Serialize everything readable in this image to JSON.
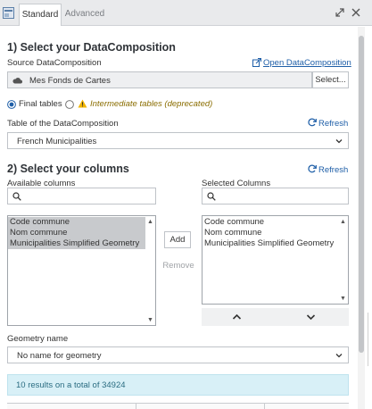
{
  "tabs": {
    "standard": "Standard",
    "advanced": "Advanced"
  },
  "section1": {
    "title": "1) Select your DataComposition",
    "source_label": "Source DataComposition",
    "open_link": "Open DataComposition",
    "source_value": "Mes Fonds de Cartes",
    "select_button": "Select...",
    "radio_final": "Final tables",
    "radio_intermediate": "Intermediate tables (deprecated)",
    "table_label": "Table of the DataComposition",
    "refresh": "Refresh",
    "table_value": "French Municipalities"
  },
  "section2": {
    "title": "2) Select your columns",
    "refresh": "Refresh",
    "available_label": "Available columns",
    "selected_label": "Selected Columns",
    "available_items": [
      "Code commune",
      "Nom commune",
      "Municipalities Simplified Geometry"
    ],
    "selected_items": [
      "Code commune",
      "Nom commune",
      "Municipalities Simplified Geometry"
    ],
    "add_button": "Add",
    "remove_button": "Remove"
  },
  "geometry": {
    "label": "Geometry name",
    "value": "No name for geometry"
  },
  "results": {
    "text": "10 results on a total of 34924"
  },
  "colors": {
    "accent": "#1f5fa8",
    "warning": "#f0b400",
    "info_bg": "#d8f0f7"
  },
  "icons": {
    "app": "window-icon",
    "expand": "expand-icon",
    "close": "close-icon",
    "external": "external-link-icon",
    "cloud": "cloud-icon",
    "warning": "warning-icon",
    "refresh": "refresh-icon",
    "search": "search-icon",
    "up": "chevron-up-icon",
    "down": "chevron-down-icon"
  }
}
